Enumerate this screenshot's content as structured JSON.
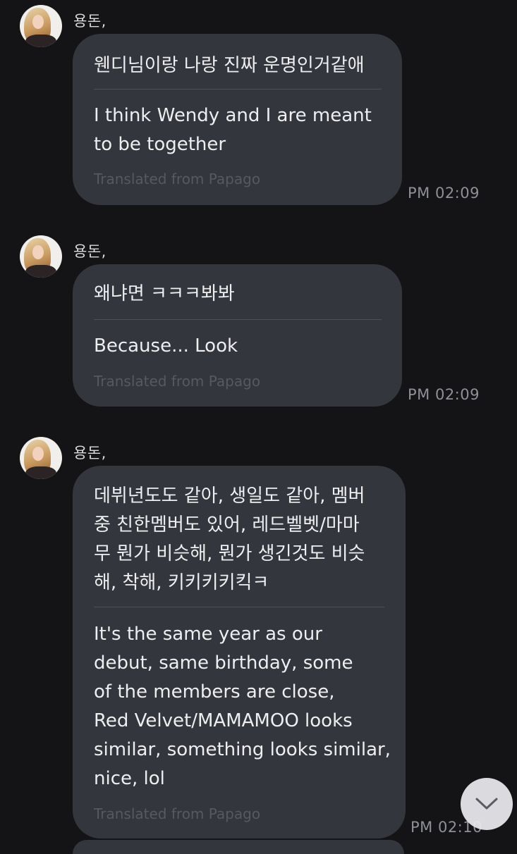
{
  "messages": [
    {
      "sender": "용돈,",
      "original": "웬디님이랑 나랑 진짜 운명인거같애",
      "translated": "I think Wendy and I are meant\nto be together",
      "source": "Translated from Papago",
      "time": "PM 02:09"
    },
    {
      "sender": "용돈,",
      "original": "왜냐면 ㅋㅋㅋ봐봐",
      "translated": "Because... Look",
      "source": "Translated from Papago",
      "time": "PM 02:09"
    },
    {
      "sender": "용돈,",
      "original": "데뷔년도도 같아, 생일도 같아, 멤버\n중 친한멤버도 있어, 레드벨벳/마마\n무 뭔가 비슷해, 뭔가 생긴것도 비슷\n해, 착해, 키키키키킥ㅋ",
      "translated": "It's the same year as our\ndebut, same birthday, some\nof the members are close,\nRed Velvet/MAMAMOO looks\nsimilar, something looks similar,\nnice, lol",
      "source": "Translated from Papago",
      "time": "PM 02:10"
    }
  ],
  "scroll_button": {
    "icon": "chevron-down-icon"
  },
  "colors": {
    "background": "#141416",
    "bubble": "#34363d",
    "source_text": "#565962",
    "time_text": "#8e9098"
  }
}
